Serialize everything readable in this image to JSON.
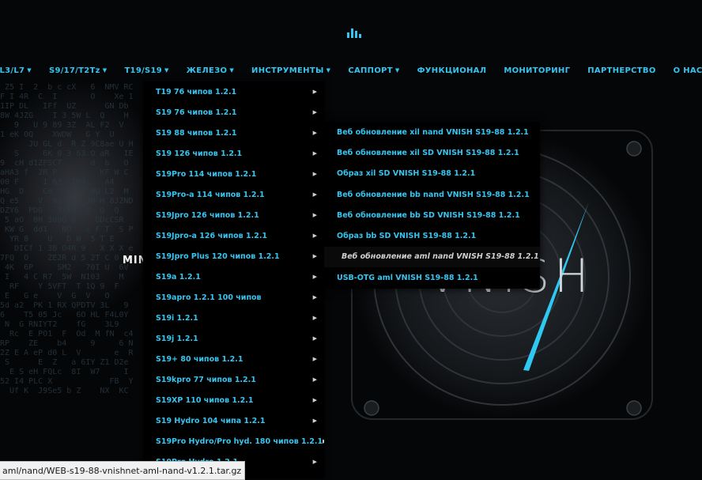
{
  "nav": [
    {
      "label": "L3/L7",
      "caret": true
    },
    {
      "label": "S9/17/T2Tz",
      "caret": true
    },
    {
      "label": "T19/S19",
      "caret": true
    },
    {
      "label": "ЖЕЛЕЗО",
      "caret": true
    },
    {
      "label": "ИНСТРУМЕНТЫ",
      "caret": true
    },
    {
      "label": "САППОРТ",
      "caret": true
    },
    {
      "label": "ФУНКЦИОНАЛ",
      "caret": false
    },
    {
      "label": "МОНИТОРИНГ",
      "caret": false
    },
    {
      "label": "ПАРТНЕРСТВО",
      "caret": false
    },
    {
      "label": "О НАС",
      "caret": false
    }
  ],
  "dropdown": [
    "T19 76 чипов 1.2.1",
    "S19 76 чипов 1.2.1",
    "S19 88 чипов 1.2.1",
    "S19 126 чипов 1.2.1",
    "S19Pro 114 чипов 1.2.1",
    "S19Pro-a 114 чипов 1.2.1",
    "S19Jpro 126 чипов 1.2.1",
    "S19Jpro-a 126 чипов 1.2.1",
    "S19Jpro Plus 120 чипов 1.2.1",
    "S19a 1.2.1",
    "S19apro 1.2.1 100 чипов",
    "S19i 1.2.1",
    "S19j 1.2.1",
    "S19+ 80 чипов 1.2.1",
    "S19kpro 77 чипов 1.2.1",
    "S19XP 110 чипов 1.2.1",
    "S19 Hydro 104 чипа 1.2.1",
    "S19Pro Hydro/Pro hyd. 180 чипов 1.2.1",
    "S19Pro Hydro 1.2.1"
  ],
  "submenu": [
    "Веб обновление xil nand VNISH S19-88 1.2.1",
    "Веб обновление xil SD VNISH S19-88 1.2.1",
    "Образ xil SD VNISH S19-88 1.2.1",
    "Веб обновление bb nand VNISH S19-88 1.2.1",
    "Веб обновление bb SD VNISH S19-88 1.2.1",
    "Образ bb SD VNISH S19-88 1.2.1",
    "Веб обновление aml nand VNISH S19-88 1.2.1",
    "USB-OTG aml VNISH S19-88 1.2.1"
  ],
  "submenu_active_index": 6,
  "hero": {
    "mini_text": "MIN",
    "brand": "VNISH"
  },
  "status_url": "aml/nand/WEB-s19-88-vnishnet-aml-nand-v1.2.1.tar.gz",
  "colors": {
    "accent": "#35c5f0",
    "bg": "#050608"
  }
}
